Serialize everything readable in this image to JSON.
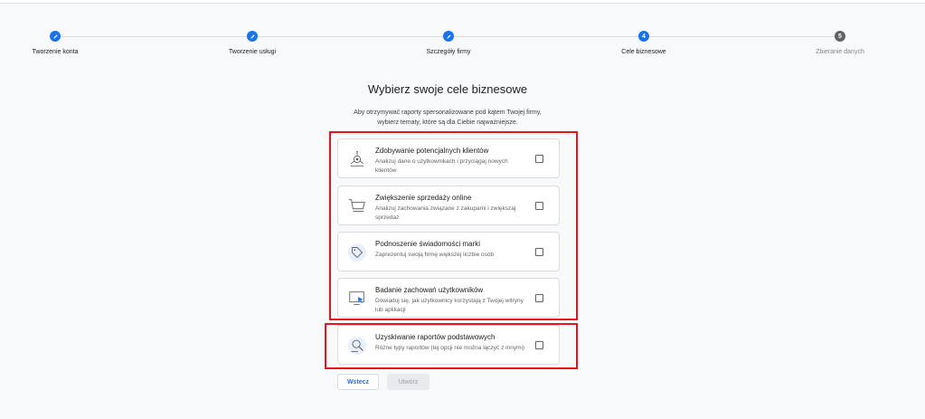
{
  "stepper": {
    "steps": [
      {
        "label": "Tworzenie konta",
        "marker": "pencil-icon",
        "state": "done"
      },
      {
        "label": "Tworzenie usługi",
        "marker": "pencil-icon",
        "state": "done"
      },
      {
        "label": "Szczegóły firmy",
        "marker": "pencil-icon",
        "state": "done"
      },
      {
        "label": "Cele biznesowe",
        "marker": "4",
        "state": "current"
      },
      {
        "label": "Zbieranie danych",
        "marker": "5",
        "state": "pending"
      }
    ]
  },
  "page": {
    "title": "Wybierz swoje cele biznesowe",
    "subtitle_line1": "Aby otrzymywać raporty spersonalizowane pod kątem Twojej firmy,",
    "subtitle_line2": "wybierz tematy, które są dla Ciebie najważniejsze."
  },
  "goals": [
    {
      "title": "Zdobywanie potencjalnych klientów",
      "desc": "Analizuj dane o użytkownikach i przyciągaj nowych klientów",
      "icon": "target-icon",
      "checked": false
    },
    {
      "title": "Zwiększenie sprzedaży online",
      "desc": "Analizuj zachowania związane z zakupami i zwiększaj sprzedaż",
      "icon": "cart-icon",
      "checked": false
    },
    {
      "title": "Podnoszenie świadomości marki",
      "desc": "Zaprezentuj swoją firmę większej liczbie osób",
      "icon": "tag-icon",
      "checked": false
    },
    {
      "title": "Badanie zachowań użytkowników",
      "desc": "Dowiaduj się, jak użytkownicy korzystają z Twojej witryny lub aplikacji",
      "icon": "monitor-cursor-icon",
      "checked": false
    },
    {
      "title": "Uzyskiwanie raportów podstawowych",
      "desc": "Różne typy raportów (tej opcji nie można łączyć z innymi)",
      "icon": "report-search-icon",
      "checked": false
    }
  ],
  "buttons": {
    "back": "Wstecz",
    "create": "Utwórz"
  },
  "colors": {
    "accent": "#1a73e8",
    "highlight": "#e8131b",
    "pending": "#5f6368"
  }
}
